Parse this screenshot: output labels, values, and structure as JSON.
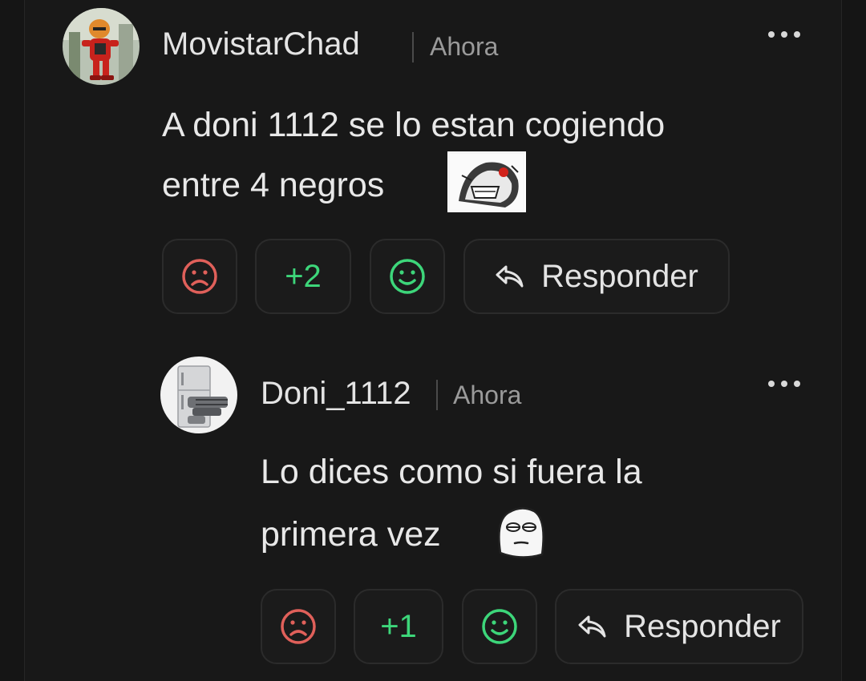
{
  "comments": [
    {
      "username": "MovistarChad",
      "time": "Ahora",
      "text_lines": [
        "A doni 1112 se lo estan cogiendo",
        "entre 4 negros"
      ],
      "score": "+2",
      "reply_label": "Responder",
      "avatar_icon": "red-character-avatar",
      "emote_icon": "rage-face-emote"
    },
    {
      "username": "Doni_1112",
      "time": "Ahora",
      "text_lines": [
        "Lo dices como si fuera la",
        "primera vez"
      ],
      "score": "+1",
      "reply_label": "Responder",
      "avatar_icon": "fridge-minigun-avatar",
      "emote_icon": "meme-face-emote"
    }
  ],
  "colors": {
    "background": "#181818",
    "text": "#e8e8e8",
    "muted": "#9a9a9a",
    "dislike": "#e0605a",
    "like": "#3dd67a",
    "button_border": "#2b2b2b"
  }
}
